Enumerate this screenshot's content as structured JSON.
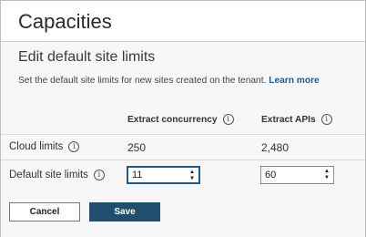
{
  "page": {
    "title": "Capacities"
  },
  "section": {
    "title": "Edit default site limits",
    "description": "Set the default site limits for new sites created on the tenant.",
    "learn_more": "Learn more"
  },
  "columns": [
    {
      "label": "Extract concurrency",
      "icon": "info-icon"
    },
    {
      "label": "Extract APIs",
      "icon": "info-icon"
    }
  ],
  "rows": {
    "cloud_limits": {
      "label": "Cloud limits",
      "icon": "info-icon",
      "concurrency": "250",
      "apis": "2,480"
    },
    "default_site_limits": {
      "label": "Default site limits",
      "icon": "info-icon",
      "concurrency": "11",
      "apis": "60"
    }
  },
  "buttons": {
    "cancel": "Cancel",
    "save": "Save"
  },
  "colors": {
    "accent": "#1f4e6e",
    "link": "#1f5a8a",
    "focus": "#1f5a8a"
  }
}
